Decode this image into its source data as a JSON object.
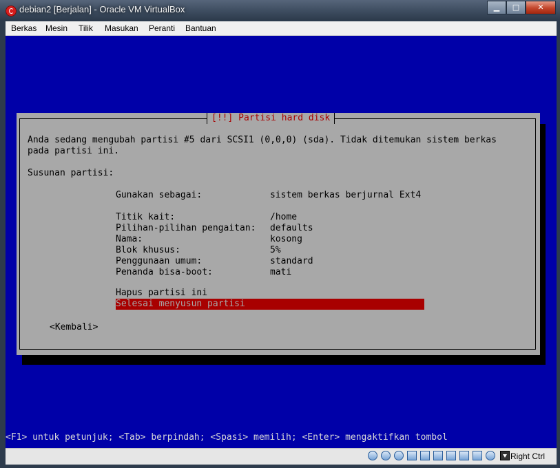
{
  "window": {
    "title": "debian2 [Berjalan] - Oracle VM VirtualBox",
    "minimize": "▁",
    "maximize": "□",
    "close": "✕"
  },
  "menubar": [
    "Berkas",
    "Mesin",
    "Tilik",
    "Masukan",
    "Peranti",
    "Bantuan"
  ],
  "dialog": {
    "title": "[!!] Partisi hard disk",
    "intro1": "Anda sedang mengubah partisi #5 dari SCSI1 (0,0,0) (sda). Tidak ditemukan sistem berkas",
    "intro2": "pada partisi ini.",
    "heading": "Susunan partisi:",
    "settings": [
      {
        "label": "Gunakan sebagai:",
        "value": "sistem berkas berjurnal Ext4"
      },
      {
        "label": "Titik kait:",
        "value": "/home"
      },
      {
        "label": "Pilihan-pilihan pengaitan:",
        "value": "defaults"
      },
      {
        "label": "Nama:",
        "value": "kosong"
      },
      {
        "label": "Blok khusus:",
        "value": "5%"
      },
      {
        "label": "Penggunaan umum:",
        "value": "standard"
      },
      {
        "label": "Penanda bisa-boot:",
        "value": "mati"
      }
    ],
    "delete_partition": "Hapus partisi ini",
    "done_partition": "Selesai menyusun partisi",
    "back": "<Kembali>"
  },
  "help_line": "<F1> untuk petunjuk; <Tab> berpindah; <Spasi> memilih; <Enter> mengaktifkan tombol",
  "statusbar": {
    "host_key": "Right Ctrl"
  }
}
